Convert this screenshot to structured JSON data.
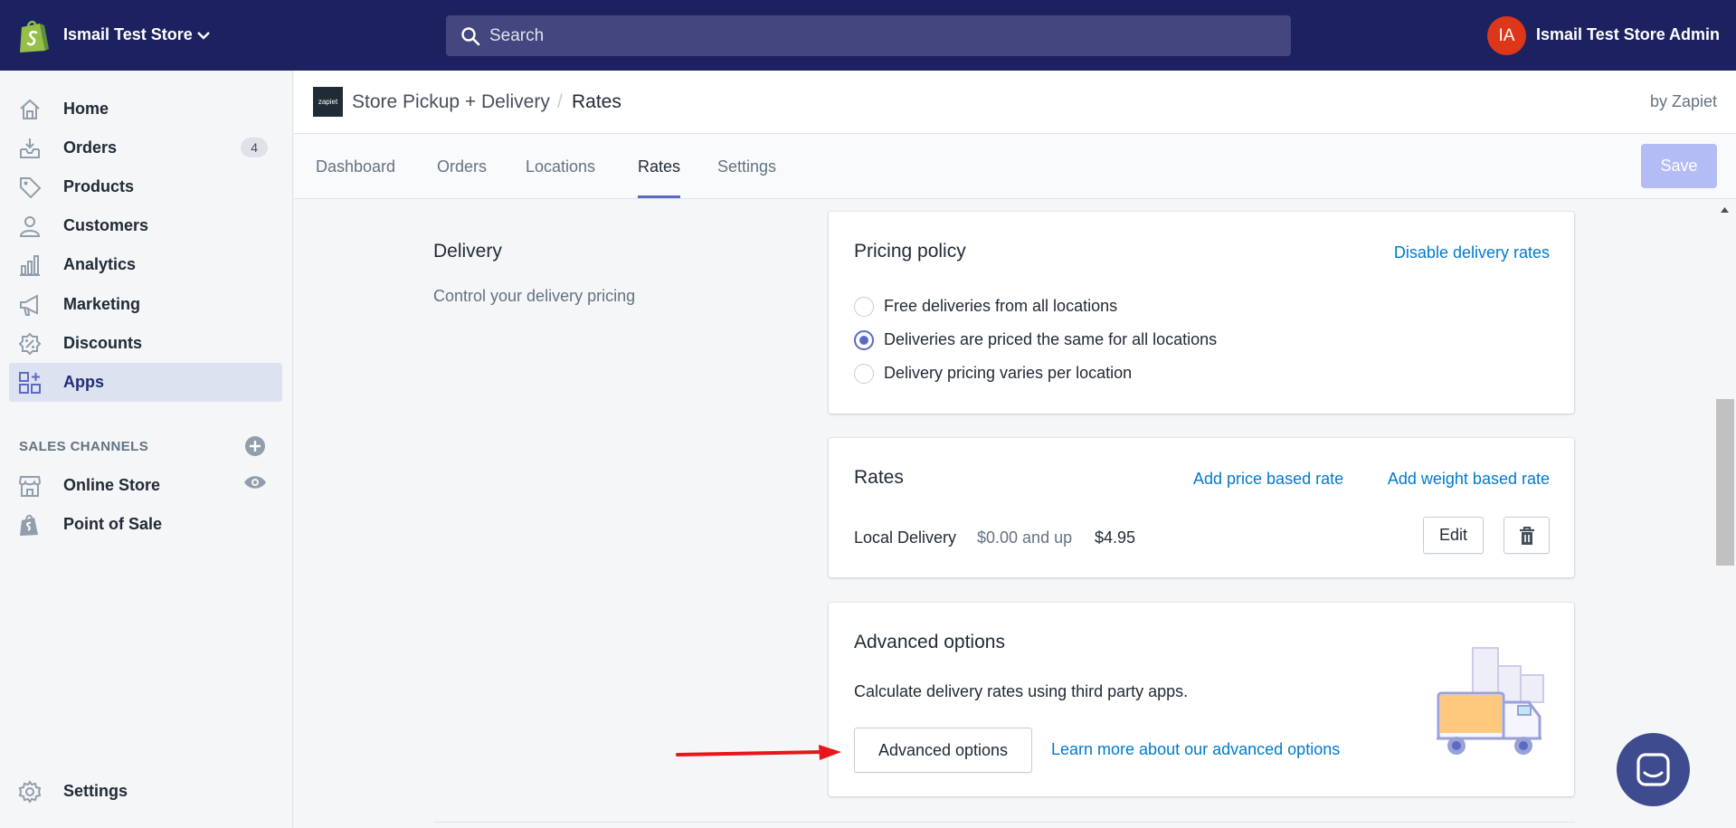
{
  "topbar": {
    "store_name": "Ismail Test Store",
    "search_placeholder": "Search",
    "avatar_initials": "IA",
    "admin_name": "Ismail Test Store Admin"
  },
  "sidebar": {
    "items": [
      {
        "label": "Home",
        "icon": "home-icon"
      },
      {
        "label": "Orders",
        "icon": "orders-icon",
        "badge": "4"
      },
      {
        "label": "Products",
        "icon": "tag-icon"
      },
      {
        "label": "Customers",
        "icon": "person-icon"
      },
      {
        "label": "Analytics",
        "icon": "bar-chart-icon"
      },
      {
        "label": "Marketing",
        "icon": "megaphone-icon"
      },
      {
        "label": "Discounts",
        "icon": "discount-icon"
      },
      {
        "label": "Apps",
        "icon": "apps-icon",
        "active": true
      }
    ],
    "sales_channels_label": "SALES CHANNELS",
    "channels": [
      {
        "label": "Online Store",
        "icon": "store-icon"
      },
      {
        "label": "Point of Sale",
        "icon": "shopify-bag-icon"
      }
    ],
    "settings_label": "Settings"
  },
  "app_header": {
    "logo_text": "zapiet",
    "app_name": "Store Pickup + Delivery",
    "separator": "/",
    "page": "Rates",
    "by": "by Zapiet"
  },
  "tabs": {
    "items": [
      "Dashboard",
      "Orders",
      "Locations",
      "Rates",
      "Settings"
    ],
    "active": "Rates",
    "save_label": "Save"
  },
  "delivery_section": {
    "title": "Delivery",
    "description": "Control your delivery pricing"
  },
  "pricing_policy": {
    "title": "Pricing policy",
    "disable_link": "Disable delivery rates",
    "options": [
      {
        "label": "Free deliveries from all locations",
        "checked": false
      },
      {
        "label": "Deliveries are priced the same for all locations",
        "checked": true
      },
      {
        "label": "Delivery pricing varies per location",
        "checked": false
      }
    ]
  },
  "rates": {
    "title": "Rates",
    "add_price_link": "Add price based rate",
    "add_weight_link": "Add weight based rate",
    "rows": [
      {
        "name": "Local Delivery",
        "condition": "$0.00 and up",
        "price": "$4.95"
      }
    ],
    "edit_label": "Edit"
  },
  "advanced": {
    "title": "Advanced options",
    "description": "Calculate delivery rates using third party apps.",
    "button_label": "Advanced options",
    "learn_more_link": "Learn more about our advanced options"
  },
  "colors": {
    "topbar": "#1c2260",
    "accent": "#5c6ac4",
    "link": "#007ace",
    "annotation_arrow": "#e8151b"
  }
}
